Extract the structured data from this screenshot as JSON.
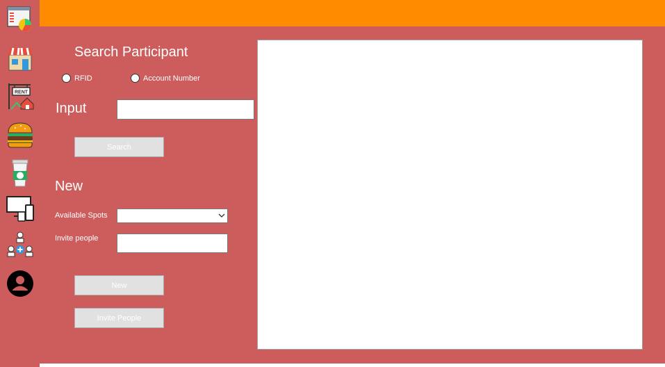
{
  "sidebar": {
    "items": [
      {
        "icon": "dashboard-chart-icon"
      },
      {
        "icon": "store-icon"
      },
      {
        "icon": "rent-sign-icon"
      },
      {
        "icon": "burger-icon"
      },
      {
        "icon": "coffee-cup-icon"
      },
      {
        "icon": "devices-icon"
      },
      {
        "icon": "team-add-icon"
      },
      {
        "icon": "user-profile-icon"
      }
    ]
  },
  "colors": {
    "background": "#cd5c5c",
    "topbar": "#ff8c00",
    "panel": "#ffffff"
  },
  "search": {
    "title": "Search Participant",
    "radio_rfid": "RFID",
    "radio_account": "Account Number",
    "input_label": "Input",
    "input_value": "",
    "search_button": "Search"
  },
  "new_section": {
    "title": "New",
    "spots_label": "Available Spots",
    "spots_value": "",
    "invite_label": "Invite people",
    "invite_value": "",
    "new_button": "New",
    "invite_button": "Invite People"
  }
}
